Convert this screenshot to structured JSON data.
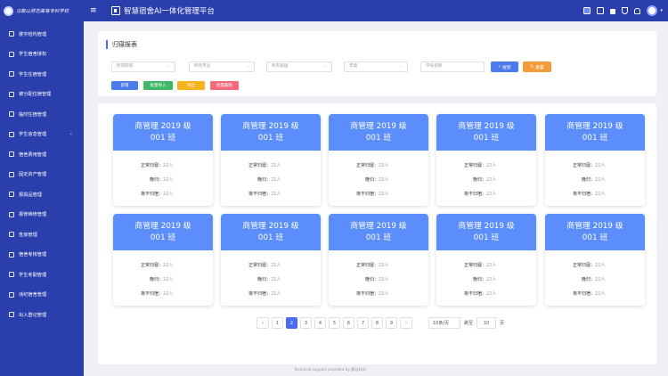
{
  "brand": {
    "school_name": "马鞍山师范高等专科学校"
  },
  "header": {
    "app_title": "智慧宿舍AI一体化管理平台"
  },
  "sidebar": {
    "items": [
      {
        "label": "楼宇结构管理"
      },
      {
        "label": "学生宿舍授权"
      },
      {
        "label": "学生住宿管理"
      },
      {
        "label": "被分配住宿管理"
      },
      {
        "label": "临时住宿管理"
      },
      {
        "label": "学生信息管理"
      },
      {
        "label": "宿舍费用管理"
      },
      {
        "label": "固定资产管理"
      },
      {
        "label": "报损品管理"
      },
      {
        "label": "报修维修管理"
      },
      {
        "label": "查房管理"
      },
      {
        "label": "宿舍考核管理"
      },
      {
        "label": "学生考勤管理"
      },
      {
        "label": "违纪宿舍管理"
      },
      {
        "label": "出入登记管理"
      }
    ]
  },
  "page": {
    "title": "归寝报表",
    "filters": {
      "dept_placeholder": "所有院系",
      "major_placeholder": "所有专业",
      "class_placeholder": "所有班级",
      "grade_placeholder": "年级",
      "keyword_placeholder": "学号名称"
    },
    "buttons": {
      "search": "搜索",
      "reset": "重置",
      "add": "新增",
      "import": "批量导入",
      "export": "导出",
      "delete": "批量删除"
    }
  },
  "cards": [
    {
      "title_line1": "商管理 2019 级",
      "title_line2": "001 班",
      "normal_label": "正常归寝：",
      "normal_value": "22人",
      "late_label": "晚归：",
      "late_value": "22人",
      "absent_label": "夜不归宿：",
      "absent_value": "22人"
    },
    {
      "title_line1": "商管理 2019 级",
      "title_line2": "001 班",
      "normal_label": "正常归寝：",
      "normal_value": "22人",
      "late_label": "晚归：",
      "late_value": "22人",
      "absent_label": "夜不归宿：",
      "absent_value": "22人"
    },
    {
      "title_line1": "商管理 2019 级",
      "title_line2": "001 班",
      "normal_label": "正常归寝：",
      "normal_value": "22人",
      "late_label": "晚归：",
      "late_value": "22人",
      "absent_label": "夜不归宿：",
      "absent_value": "22人"
    },
    {
      "title_line1": "商管理 2019 级",
      "title_line2": "001 班",
      "normal_label": "正常归寝：",
      "normal_value": "22人",
      "late_label": "晚归：",
      "late_value": "22人",
      "absent_label": "夜不归宿：",
      "absent_value": "22人"
    },
    {
      "title_line1": "商管理 2019 级",
      "title_line2": "001 班",
      "normal_label": "正常归寝：",
      "normal_value": "22人",
      "late_label": "晚归：",
      "late_value": "22人",
      "absent_label": "夜不归宿：",
      "absent_value": "22人"
    },
    {
      "title_line1": "商管理 2019 级",
      "title_line2": "001 班",
      "normal_label": "正常归寝：",
      "normal_value": "22人",
      "late_label": "晚归：",
      "late_value": "22人",
      "absent_label": "夜不归宿：",
      "absent_value": "22人"
    },
    {
      "title_line1": "商管理 2019 级",
      "title_line2": "001 班",
      "normal_label": "正常归寝：",
      "normal_value": "22人",
      "late_label": "晚归：",
      "late_value": "22人",
      "absent_label": "夜不归宿：",
      "absent_value": "22人"
    },
    {
      "title_line1": "商管理 2019 级",
      "title_line2": "001 班",
      "normal_label": "正常归寝：",
      "normal_value": "22人",
      "late_label": "晚归：",
      "late_value": "22人",
      "absent_label": "夜不归宿：",
      "absent_value": "22人"
    },
    {
      "title_line1": "商管理 2019 级",
      "title_line2": "001 班",
      "normal_label": "正常归寝：",
      "normal_value": "22人",
      "late_label": "晚归：",
      "late_value": "22人",
      "absent_label": "夜不归宿：",
      "absent_value": "22人"
    },
    {
      "title_line1": "商管理 2019 级",
      "title_line2": "001 班",
      "normal_label": "正常归寝：",
      "normal_value": "22人",
      "late_label": "晚归：",
      "late_value": "22人",
      "absent_label": "夜不归宿：",
      "absent_value": "22人"
    }
  ],
  "pagination": {
    "prev": "‹",
    "next": "›",
    "pages": [
      "1",
      "2",
      "3",
      "4",
      "5",
      "6",
      "7",
      "8",
      "9"
    ],
    "current": "2",
    "page_size": "10条/页",
    "goto_label": "跳至",
    "goto_value": "10",
    "page_unit": "页"
  },
  "footer": {
    "text": "Technical support provided by 豪云科技"
  },
  "theme": {
    "primary": "#2a3fab",
    "card_header": "#5b8dfb",
    "accent": "#4b6cf0"
  }
}
